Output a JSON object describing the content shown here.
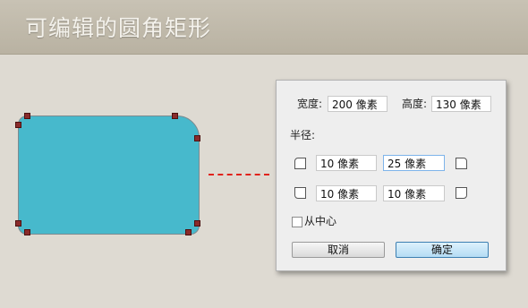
{
  "header": {
    "title": "可编辑的圆角矩形"
  },
  "dialog": {
    "width_label": "宽度:",
    "width_value": "200 像素",
    "height_label": "高度:",
    "height_value": "130 像素",
    "radius_label": "半径:",
    "radius": {
      "top_left": "10 像素",
      "top_right": "25 像素",
      "bottom_left": "10 像素",
      "bottom_right": "10 像素"
    },
    "from_center_label": "从中心",
    "from_center_checked": false,
    "cancel_label": "取消",
    "ok_label": "确定"
  },
  "colors": {
    "shape_fill": "#47b9cc",
    "connector": "#e0231c",
    "handle": "#8a2b2b",
    "ok_button": "#b4dcf4"
  }
}
